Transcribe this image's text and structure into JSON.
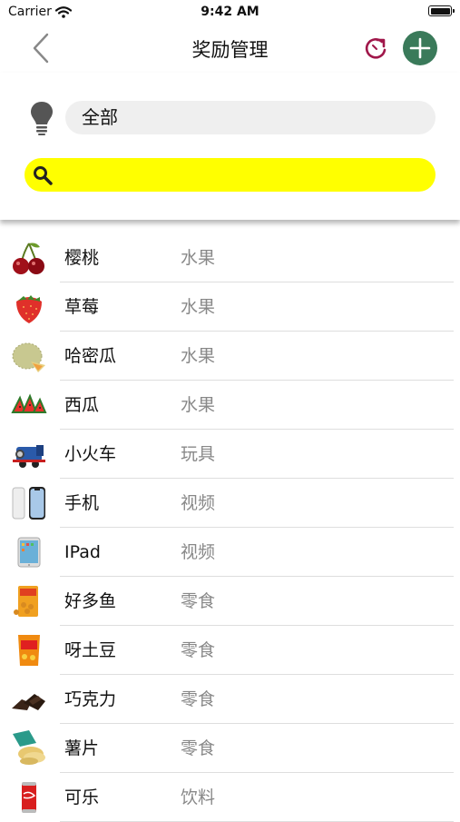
{
  "status_bar": {
    "carrier": "Carrier",
    "time": "9:42 AM"
  },
  "nav": {
    "title": "奖励管理"
  },
  "filter": {
    "category": "全部",
    "search_value": ""
  },
  "colors": {
    "accent_green": "#3a7a5a",
    "refresh_red": "#a0174a",
    "search_yellow": "#ffff00"
  },
  "rewards": [
    {
      "name": "樱桃",
      "category": "水果",
      "icon": "cherry-icon"
    },
    {
      "name": "草莓",
      "category": "水果",
      "icon": "strawberry-icon"
    },
    {
      "name": "哈密瓜",
      "category": "水果",
      "icon": "melon-icon"
    },
    {
      "name": "西瓜",
      "category": "水果",
      "icon": "watermelon-icon"
    },
    {
      "name": "小火车",
      "category": "玩具",
      "icon": "toy-train-icon"
    },
    {
      "name": "手机",
      "category": "视频",
      "icon": "phone-icon"
    },
    {
      "name": "IPad",
      "category": "视频",
      "icon": "ipad-icon"
    },
    {
      "name": "好多鱼",
      "category": "零食",
      "icon": "snack-box-icon"
    },
    {
      "name": "呀土豆",
      "category": "零食",
      "icon": "chips-bag-icon"
    },
    {
      "name": "巧克力",
      "category": "零食",
      "icon": "chocolate-icon"
    },
    {
      "name": "薯片",
      "category": "零食",
      "icon": "potato-chips-icon"
    },
    {
      "name": "可乐",
      "category": "饮料",
      "icon": "cola-can-icon"
    }
  ]
}
